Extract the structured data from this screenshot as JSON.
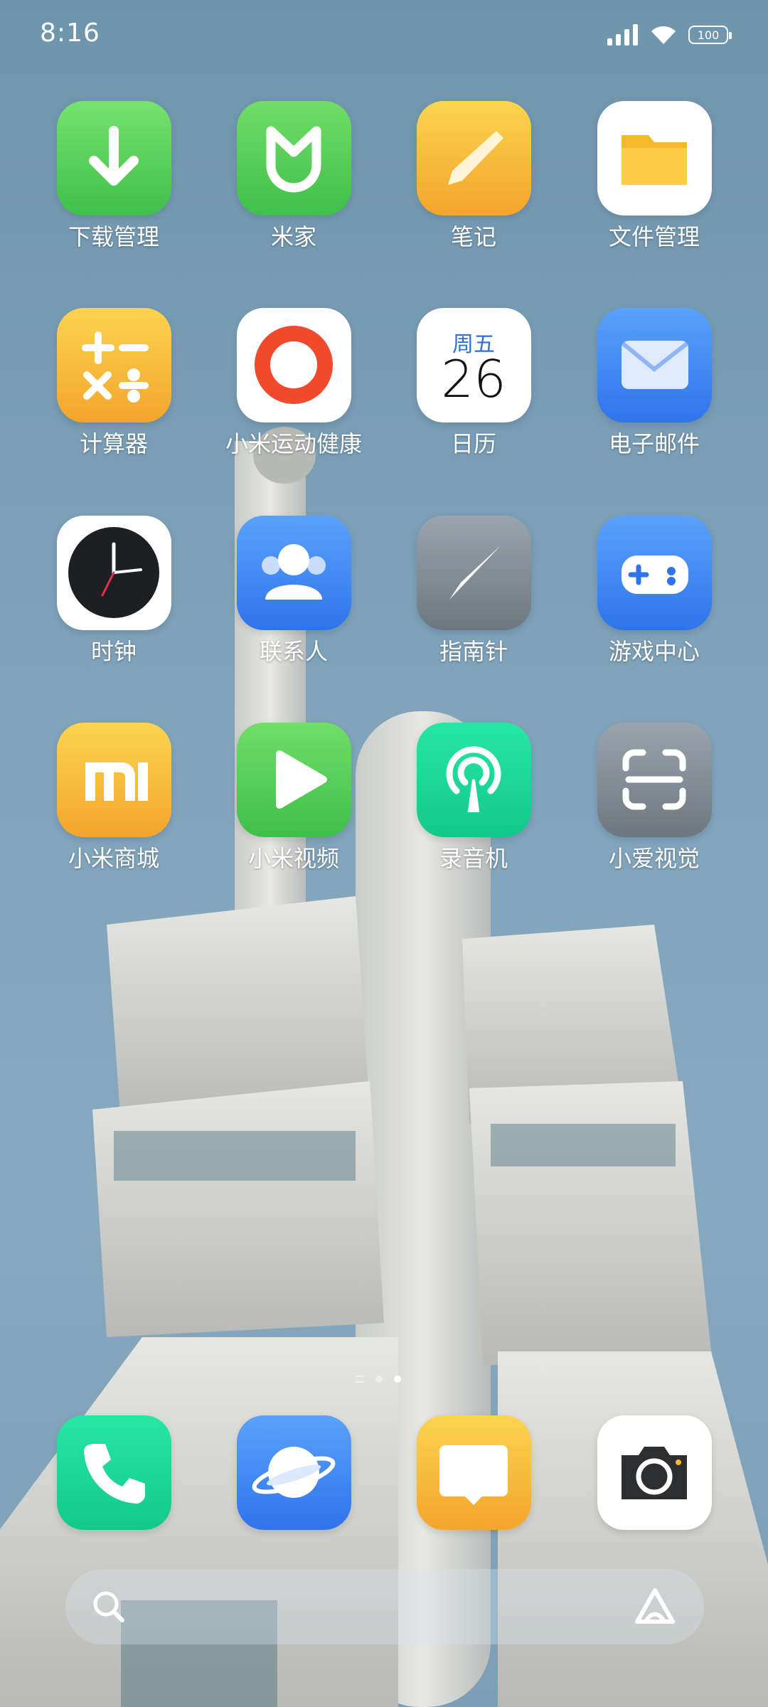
{
  "status_bar": {
    "time": "8:16",
    "battery": "100"
  },
  "apps": [
    {
      "label": "下载管理",
      "icon": "download-icon"
    },
    {
      "label": "米家",
      "icon": "mijia-icon"
    },
    {
      "label": "笔记",
      "icon": "notes-icon"
    },
    {
      "label": "文件管理",
      "icon": "folder-icon"
    },
    {
      "label": "计算器",
      "icon": "calculator-icon"
    },
    {
      "label": "小米运动健康",
      "icon": "health-ring-icon"
    },
    {
      "label": "日历",
      "icon": "calendar-icon",
      "weekday": "周五",
      "date": "26"
    },
    {
      "label": "电子邮件",
      "icon": "mail-icon"
    },
    {
      "label": "时钟",
      "icon": "clock-icon"
    },
    {
      "label": "联系人",
      "icon": "contacts-icon"
    },
    {
      "label": "指南针",
      "icon": "compass-icon"
    },
    {
      "label": "游戏中心",
      "icon": "gamepad-icon"
    },
    {
      "label": "小米商城",
      "icon": "mi-store-icon"
    },
    {
      "label": "小米视频",
      "icon": "video-play-icon"
    },
    {
      "label": "录音机",
      "icon": "recorder-icon"
    },
    {
      "label": "小爱视觉",
      "icon": "scan-icon"
    }
  ],
  "dock": [
    {
      "icon": "phone-icon"
    },
    {
      "icon": "browser-icon"
    },
    {
      "icon": "messages-icon"
    },
    {
      "icon": "camera-icon"
    }
  ],
  "page_indicator": {
    "pages": 2,
    "active": 2
  },
  "colors": {
    "green": "#5fd35a",
    "yellow": "#f7be3a",
    "blue": "#3f86f2",
    "teal": "#17d79c",
    "gray": "#7d8790",
    "white": "#ffffff"
  }
}
